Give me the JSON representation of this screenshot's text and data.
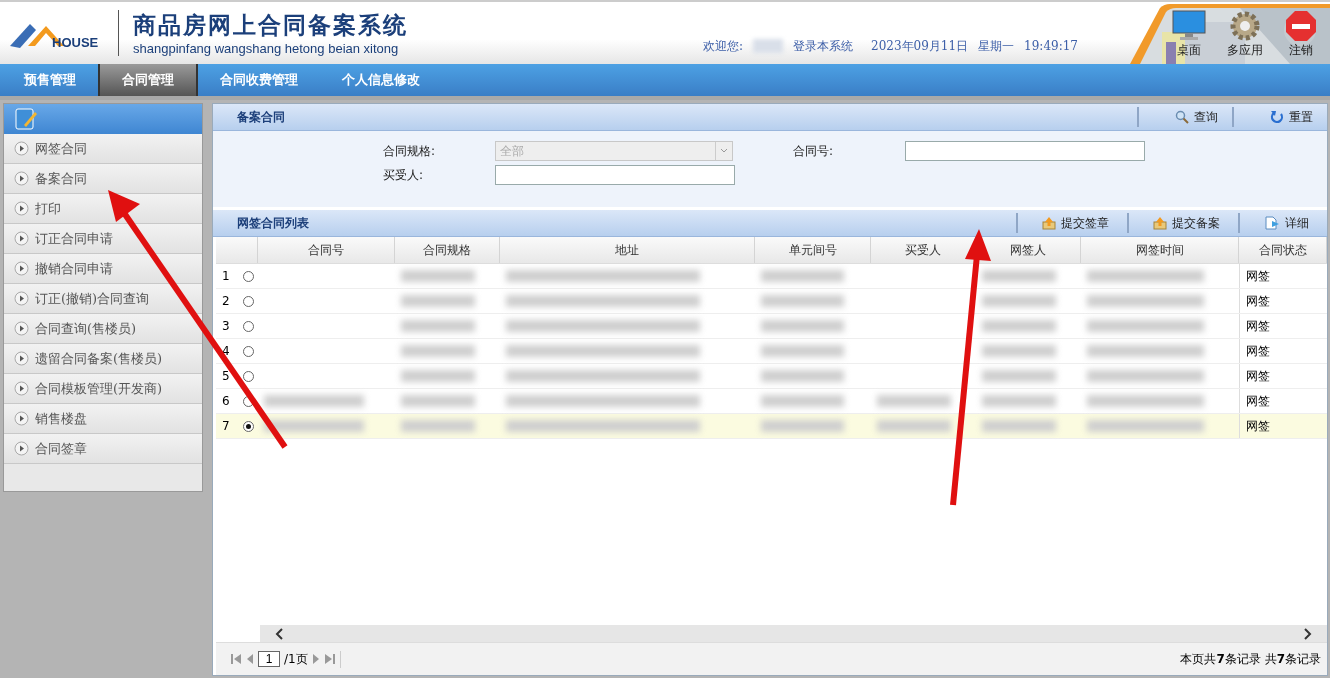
{
  "header": {
    "logo_text": "HOUSE",
    "title": "商品房网上合同备案系统",
    "subtitle": "shangpinfang wangshang hetong beian xitong",
    "welcome": "欢迎您:",
    "login_text": "登录本系统",
    "date": "2023年09月11日",
    "weekday": "星期一",
    "time": "19:49:17",
    "shortcuts": [
      {
        "kind": "desktop",
        "label": "桌面"
      },
      {
        "kind": "gear",
        "label": "多应用"
      },
      {
        "kind": "logout",
        "label": "注销"
      }
    ]
  },
  "nav": [
    {
      "label": "预售管理",
      "selected": false
    },
    {
      "label": "合同管理",
      "selected": true
    },
    {
      "label": "合同收费管理",
      "selected": false
    },
    {
      "label": "个人信息修改",
      "selected": false
    }
  ],
  "sidebar": {
    "items": [
      {
        "label": "网签合同"
      },
      {
        "label": "备案合同"
      },
      {
        "label": "打印"
      },
      {
        "label": "订正合同申请"
      },
      {
        "label": "撤销合同申请"
      },
      {
        "label": "订正(撤销)合同查询"
      },
      {
        "label": "合同查询(售楼员)"
      },
      {
        "label": "遗留合同备案(售楼员)"
      },
      {
        "label": "合同模板管理(开发商)"
      },
      {
        "label": "销售楼盘"
      },
      {
        "label": "合同签章"
      }
    ]
  },
  "search_panel": {
    "title": "备案合同",
    "actions": [
      {
        "kind": "search",
        "label": "查询"
      },
      {
        "kind": "reset",
        "label": "重置"
      }
    ],
    "fields": [
      {
        "label": "合同规格:",
        "kind": "select",
        "value": "全部",
        "disabled": true
      },
      {
        "label": "合同号:",
        "kind": "text"
      },
      {
        "label": "买受人:",
        "kind": "text"
      }
    ]
  },
  "list_panel": {
    "title": "网签合同列表",
    "actions": [
      {
        "kind": "upload",
        "label": "提交签章"
      },
      {
        "kind": "upload",
        "label": "提交备案"
      },
      {
        "kind": "detail",
        "label": "详细"
      }
    ],
    "table": {
      "columns": [
        "合同号",
        "合同规格",
        "地址",
        "单元间号",
        "买受人",
        "网签人",
        "网签时间",
        "合同状态"
      ],
      "rows": [
        {
          "number": "1",
          "selected": false,
          "masked": [
            false,
            true,
            true,
            true,
            false,
            true,
            true
          ],
          "status": "网签"
        },
        {
          "number": "2",
          "selected": false,
          "masked": [
            false,
            true,
            true,
            true,
            false,
            true,
            true
          ],
          "status": "网签"
        },
        {
          "number": "3",
          "selected": false,
          "masked": [
            false,
            true,
            true,
            true,
            false,
            true,
            true
          ],
          "status": "网签"
        },
        {
          "number": "4",
          "selected": false,
          "masked": [
            false,
            true,
            true,
            true,
            false,
            true,
            true
          ],
          "status": "网签"
        },
        {
          "number": "5",
          "selected": false,
          "masked": [
            false,
            true,
            true,
            true,
            false,
            true,
            true
          ],
          "status": "网签"
        },
        {
          "number": "6",
          "selected": false,
          "masked": [
            true,
            true,
            true,
            true,
            true,
            true,
            true
          ],
          "status": "网签"
        },
        {
          "number": "7",
          "selected": true,
          "masked": [
            true,
            true,
            true,
            true,
            true,
            true,
            true
          ],
          "status": "网签"
        }
      ]
    },
    "pager": {
      "page": "1",
      "total_pages": "/1页",
      "summary": "本页共**7**条记录 共**7**条记录"
    }
  }
}
